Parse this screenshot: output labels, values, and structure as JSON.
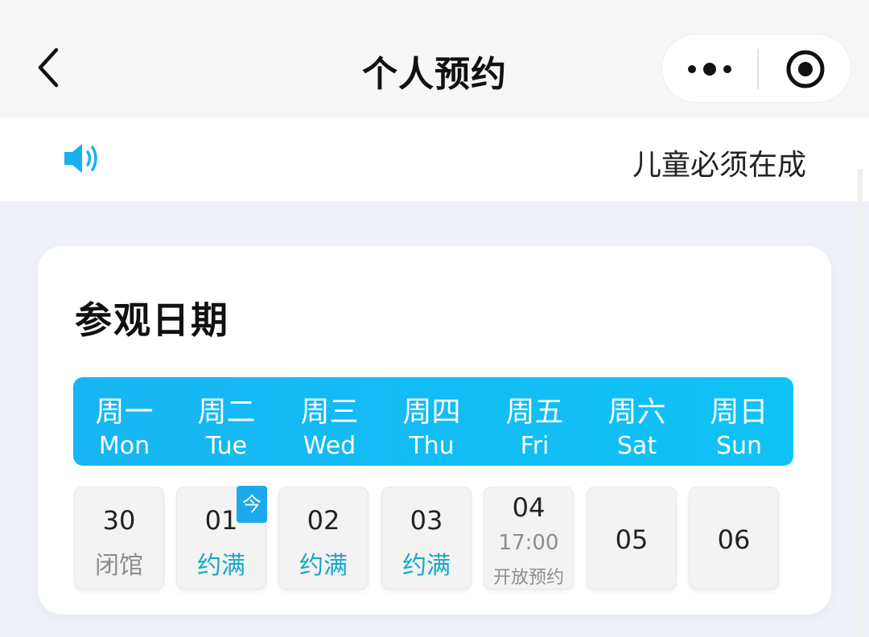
{
  "navbar": {
    "title": "个人预约",
    "back_icon": "chevron-left-icon",
    "more_icon": "more-dots-icon",
    "close_icon": "target-circle-icon"
  },
  "notice": {
    "icon": "speaker-icon",
    "text": "儿童必须在成"
  },
  "card": {
    "title": "参观日期",
    "weekdays": [
      {
        "cn": "周一",
        "en": "Mon"
      },
      {
        "cn": "周二",
        "en": "Tue"
      },
      {
        "cn": "周三",
        "en": "Wed"
      },
      {
        "cn": "周四",
        "en": "Thu"
      },
      {
        "cn": "周五",
        "en": "Fri"
      },
      {
        "cn": "周六",
        "en": "Sat"
      },
      {
        "cn": "周日",
        "en": "Sun"
      }
    ],
    "days": [
      {
        "date": "30",
        "status": "闭馆"
      },
      {
        "date": "01",
        "status": "约满",
        "badge": "今"
      },
      {
        "date": "02",
        "status": "约满"
      },
      {
        "date": "03",
        "status": "约满"
      },
      {
        "date": "04",
        "time": "17:00",
        "sub": "开放预约"
      },
      {
        "date": "05"
      },
      {
        "date": "06"
      }
    ]
  },
  "colors": {
    "accent": "#17b6f2",
    "full_text": "#15a8c9",
    "closed_text": "#8d8d8d",
    "badge": "#1ba9ec"
  }
}
